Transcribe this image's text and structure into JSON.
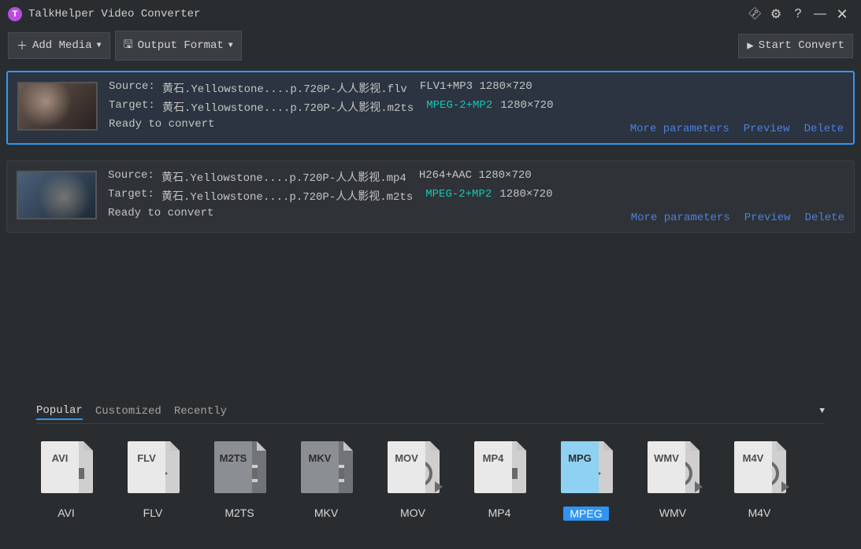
{
  "app": {
    "title": "TalkHelper Video Converter"
  },
  "toolbar": {
    "add_media": "Add Media",
    "output_format": "Output Format",
    "start_convert": "Start Convert"
  },
  "items": [
    {
      "source_label": "Source:",
      "target_label": "Target:",
      "source_file": "黄石.Yellowstone....p.720P-人人影视.flv",
      "source_codec": "FLV1+MP3 1280×720",
      "target_file": "黄石.Yellowstone....p.720P-人人影视.m2ts",
      "target_codec": "MPEG-2+MP2",
      "target_res": "1280×720",
      "status": "Ready to convert",
      "more": "More parameters",
      "preview": "Preview",
      "delete": "Delete"
    },
    {
      "source_label": "Source:",
      "target_label": "Target:",
      "source_file": "黄石.Yellowstone....p.720P-人人影视.mp4",
      "source_codec": "H264+AAC 1280×720",
      "target_file": "黄石.Yellowstone....p.720P-人人影视.m2ts",
      "target_codec": "MPEG-2+MP2",
      "target_res": "1280×720",
      "status": "Ready to convert",
      "more": "More parameters",
      "preview": "Preview",
      "delete": "Delete"
    }
  ],
  "tabs": {
    "popular": "Popular",
    "customized": "Customized",
    "recently": "Recently"
  },
  "formats": [
    {
      "ext": "AVI",
      "label": "AVI",
      "dark": false,
      "glyph": "film"
    },
    {
      "ext": "FLV",
      "label": "FLV",
      "dark": false,
      "glyph": "play"
    },
    {
      "ext": "M2TS",
      "label": "M2TS",
      "dark": true,
      "glyph": "film"
    },
    {
      "ext": "MKV",
      "label": "MKV",
      "dark": true,
      "glyph": "film"
    },
    {
      "ext": "MOV",
      "label": "MOV",
      "dark": false,
      "glyph": "circle"
    },
    {
      "ext": "MP4",
      "label": "MP4",
      "dark": false,
      "glyph": "film"
    },
    {
      "ext": "MPG",
      "label": "MPEG",
      "dark": false,
      "glyph": "play",
      "selected": true
    },
    {
      "ext": "WMV",
      "label": "WMV",
      "dark": false,
      "glyph": "circle"
    },
    {
      "ext": "M4V",
      "label": "M4V",
      "dark": false,
      "glyph": "circle"
    }
  ]
}
